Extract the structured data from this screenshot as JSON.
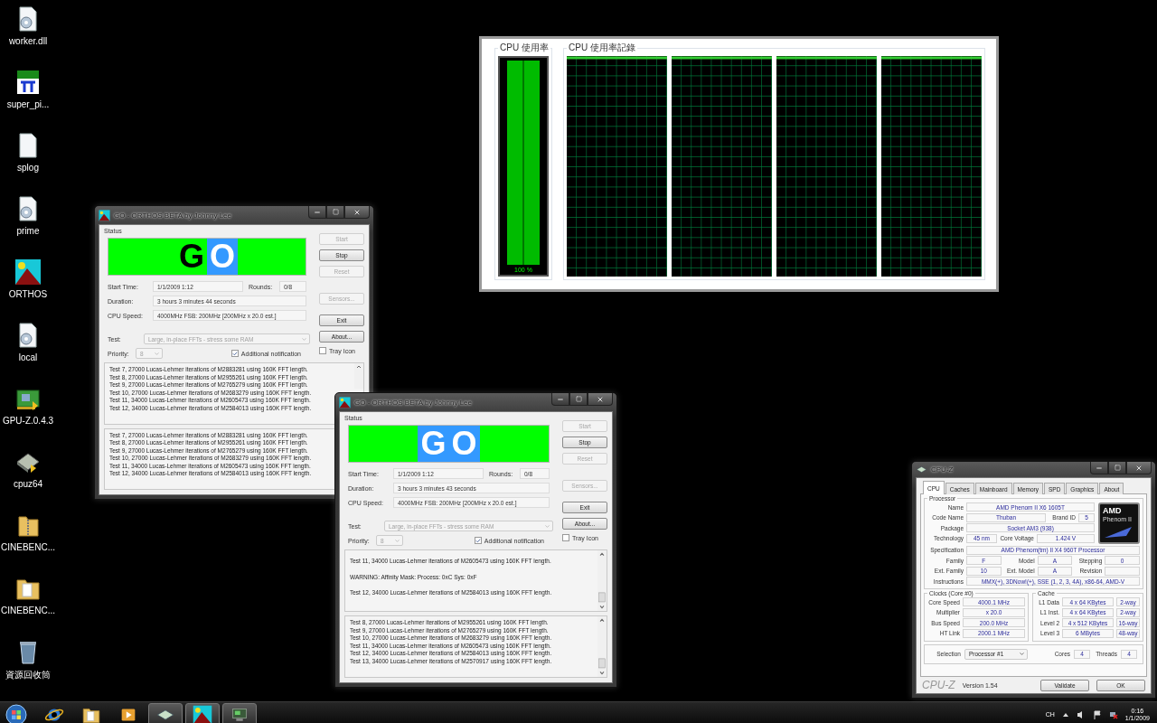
{
  "desktop_icons": [
    {
      "label": "worker.dll",
      "kind": "gear-file"
    },
    {
      "label": "super_pi...",
      "kind": "pi"
    },
    {
      "label": "splog",
      "kind": "file"
    },
    {
      "label": "prime",
      "kind": "gear-file"
    },
    {
      "label": "ORTHOS",
      "kind": "mountain"
    },
    {
      "label": "local",
      "kind": "gear-file"
    },
    {
      "label": "GPU-Z.0.4.3",
      "kind": "card"
    },
    {
      "label": "cpuz64",
      "kind": "chip"
    },
    {
      "label": "CINEBENC...",
      "kind": "zip-folder"
    },
    {
      "label": "CINEBENC...",
      "kind": "folder"
    },
    {
      "label": "資源回收筒",
      "kind": "bin"
    }
  ],
  "task_manager": {
    "usage_title": "CPU 使用率",
    "usage_meter": {
      "level": 1.0,
      "reading": "100 %"
    },
    "history_title": "CPU 使用率記錄"
  },
  "orthos_windows": [
    {
      "title": "GO - ORTHOS BETA by Johnny Lee",
      "status_label": "Status",
      "status_letters": [
        {
          "text": "G",
          "highlighted": false
        },
        {
          "text": "O",
          "highlighted": true
        }
      ],
      "start_time": {
        "label": "Start Time:",
        "value": "1/1/2009 1:12"
      },
      "rounds": {
        "label": "Rounds:",
        "value": "0/8"
      },
      "duration": {
        "label": "Duration:",
        "value": "3 hours 3 minutes 44 seconds"
      },
      "cpu_speed": {
        "label": "CPU Speed:",
        "value": "4000MHz FSB: 200MHz [200MHz x 20.0 est.]"
      },
      "test": {
        "label": "Test:",
        "value": "Large, in-place FFTs - stress some RAM",
        "disabled": true
      },
      "priority": {
        "label": "Priority:",
        "value": "8",
        "disabled": true
      },
      "buttons": [
        {
          "label": "Start",
          "disabled": true
        },
        {
          "label": "Stop",
          "disabled": false
        },
        {
          "label": "Reset",
          "disabled": true
        },
        {
          "label": "Sensors...",
          "disabled": true
        },
        {
          "label": "Exit",
          "disabled": false
        },
        {
          "label": "About...",
          "disabled": false
        }
      ],
      "additional_notification": {
        "label": "Additional notification",
        "checked": true
      },
      "tray_icon": {
        "label": "Tray Icon",
        "checked": false
      },
      "log_upper": {
        "spaced": false,
        "lines": [
          "Test 7, 27000 Lucas-Lehmer iterations of M2883281 using 160K FFT length.",
          "Test 8, 27000 Lucas-Lehmer iterations of M2955261 using 160K FFT length.",
          "Test 9, 27000 Lucas-Lehmer iterations of M2765279 using 160K FFT length.",
          "Test 10, 27000 Lucas-Lehmer iterations of M2683279 using 160K FFT length.",
          "Test 11, 34000 Lucas-Lehmer iterations of M2605473 using 160K FFT length.",
          "Test 12, 34000 Lucas-Lehmer iterations of M2584013 using 160K FFT length."
        ]
      },
      "log_lower": {
        "spaced": false,
        "lines": [
          "Test 7, 27000 Lucas-Lehmer iterations of M2883281 using 160K FFT length.",
          "Test 8, 27000 Lucas-Lehmer iterations of M2955261 using 160K FFT length.",
          "Test 9, 27000 Lucas-Lehmer iterations of M2765279 using 160K FFT length.",
          "Test 10, 27000 Lucas-Lehmer iterations of M2683279 using 160K FFT length.",
          "Test 11, 34000 Lucas-Lehmer iterations of M2605473 using 160K FFT length.",
          "Test 12, 34000 Lucas-Lehmer iterations of M2584013 using 160K FFT length."
        ]
      }
    },
    {
      "title": "GO - ORTHOS BETA by Johnny Lee",
      "status_label": "Status",
      "status_letters": [
        {
          "text": "G",
          "highlighted": true
        },
        {
          "text": "O",
          "highlighted": true
        }
      ],
      "start_time": {
        "label": "Start Time:",
        "value": "1/1/2009 1:12"
      },
      "rounds": {
        "label": "Rounds:",
        "value": "0/8"
      },
      "duration": {
        "label": "Duration:",
        "value": "3 hours 3 minutes 43 seconds"
      },
      "cpu_speed": {
        "label": "CPU Speed:",
        "value": "4000MHz FSB: 200MHz [200MHz x 20.0 est.]"
      },
      "test": {
        "label": "Test:",
        "value": "Large, in-place FFTs - stress some RAM",
        "disabled": true
      },
      "priority": {
        "label": "Priority:",
        "value": "8",
        "disabled": true
      },
      "buttons": [
        {
          "label": "Start",
          "disabled": true
        },
        {
          "label": "Stop",
          "disabled": false
        },
        {
          "label": "Reset",
          "disabled": true
        },
        {
          "label": "Sensors...",
          "disabled": true
        },
        {
          "label": "Exit",
          "disabled": false
        },
        {
          "label": "About...",
          "disabled": false
        }
      ],
      "additional_notification": {
        "label": "Additional notification",
        "checked": true
      },
      "tray_icon": {
        "label": "Tray Icon",
        "checked": false
      },
      "log_upper": {
        "spaced": true,
        "lines": [
          "Test 11, 34000 Lucas-Lehmer iterations of M2605473 using 160K FFT length.",
          "WARNING: Affinity Mask: Process: 0xC Sys: 0xF",
          "Test 12, 34000 Lucas-Lehmer iterations of M2584013 using 160K FFT length."
        ]
      },
      "log_lower": {
        "spaced": false,
        "lines": [
          "Test 8, 27000 Lucas-Lehmer iterations of M2955261 using 160K FFT length.",
          "Test 9, 27000 Lucas-Lehmer iterations of M2765279 using 160K FFT length.",
          "Test 10, 27000 Lucas-Lehmer iterations of M2683279 using 160K FFT length.",
          "Test 11, 34000 Lucas-Lehmer iterations of M2605473 using 160K FFT length.",
          "Test 12, 34000 Lucas-Lehmer iterations of M2584013 using 160K FFT length.",
          "Test 13, 34000 Lucas-Lehmer iterations of M2570917 using 160K FFT length."
        ]
      }
    }
  ],
  "cpuz": {
    "title": "CPU-Z",
    "tabs": [
      {
        "label": "CPU",
        "selected": true
      },
      {
        "label": "Caches",
        "selected": false
      },
      {
        "label": "Mainboard",
        "selected": false
      },
      {
        "label": "Memory",
        "selected": false
      },
      {
        "label": "SPD",
        "selected": false
      },
      {
        "label": "Graphics",
        "selected": false
      },
      {
        "label": "About",
        "selected": false
      }
    ],
    "processor": {
      "title": "Processor",
      "name": {
        "label": "Name",
        "value": "AMD Phenom II X6 1605T"
      },
      "code_name": {
        "label": "Code Name",
        "value": "Thuban"
      },
      "brand_id": {
        "label": "Brand ID",
        "value": "5"
      },
      "package": {
        "label": "Package",
        "value": "Socket AM3 (938)"
      },
      "technology": {
        "label": "Technology",
        "value": "45 nm"
      },
      "core_voltage": {
        "label": "Core Voltage",
        "value": "1.424 V"
      },
      "specification": {
        "label": "Specification",
        "value": "AMD Phenom(tm) II X4 960T Processor"
      },
      "family": {
        "label": "Family",
        "value": "F"
      },
      "model": {
        "label": "Model",
        "value": "A"
      },
      "stepping": {
        "label": "Stepping",
        "value": "0"
      },
      "ext_family": {
        "label": "Ext. Family",
        "value": "10"
      },
      "ext_model": {
        "label": "Ext. Model",
        "value": "A"
      },
      "revision": {
        "label": "Revision"
      },
      "instructions": {
        "label": "Instructions",
        "value": "MMX(+), 3DNow!(+), SSE (1, 2, 3, 4A), x86-64, AMD-V"
      },
      "logo": {
        "brand": "AMD",
        "line": "Phenom II"
      }
    },
    "clocks": {
      "title": "Clocks (Core #0)",
      "rows": [
        {
          "label": "Core Speed",
          "value": "4000.1 MHz"
        },
        {
          "label": "Multiplier",
          "value": "x 20.0"
        },
        {
          "label": "Bus Speed",
          "value": "200.0 MHz"
        },
        {
          "label": "HT Link",
          "value": "2000.1 MHz"
        }
      ]
    },
    "cache": {
      "title": "Cache",
      "rows": [
        {
          "label": "L1 Data",
          "size": "4 x 64 KBytes",
          "ways": "2-way"
        },
        {
          "label": "L1 Inst.",
          "size": "4 x 64 KBytes",
          "ways": "2-way"
        },
        {
          "label": "Level 2",
          "size": "4 x 512 KBytes",
          "ways": "16-way"
        },
        {
          "label": "Level 3",
          "size": "6 MBytes",
          "ways": "48-way"
        }
      ]
    },
    "selection": {
      "label": "Selection",
      "value": "Processor #1"
    },
    "cores": {
      "label": "Cores",
      "value": "4"
    },
    "threads": {
      "label": "Threads",
      "value": "4"
    },
    "footer_logo": "CPU-Z",
    "version": "Version 1.54",
    "buttons": [
      "Validate",
      "OK"
    ]
  },
  "taskbar": {
    "items": [
      {
        "kind": "browser",
        "running": false
      },
      {
        "kind": "folder",
        "running": false
      },
      {
        "kind": "media",
        "running": false
      },
      {
        "kind": "diamond",
        "running": true
      },
      {
        "kind": "mountain",
        "running": true
      },
      {
        "kind": "monitor",
        "running": true
      }
    ],
    "language": "CH",
    "time": "0:16",
    "date": "1/1/2009"
  }
}
